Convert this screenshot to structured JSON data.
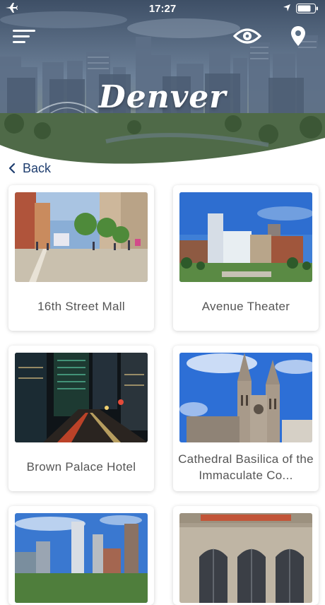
{
  "status_bar": {
    "time": "17:27",
    "airplane_icon": "airplane-icon",
    "location_icon": "location-arrow-icon",
    "battery_icon": "battery-icon"
  },
  "header": {
    "city_title": "Denver",
    "menu_icon": "hamburger-menu-icon",
    "view_icon": "eye-icon",
    "map_icon": "map-pin-icon"
  },
  "navigation": {
    "back_label": "Back"
  },
  "places": [
    {
      "name": "16th Street Mall",
      "image": "street-mall-photo"
    },
    {
      "name": "Avenue Theater",
      "image": "city-skyline-photo"
    },
    {
      "name": "Brown Palace Hotel",
      "image": "night-street-photo"
    },
    {
      "name": "Cathedral Basilica of the Immaculate Co...",
      "image": "cathedral-photo"
    },
    {
      "name": "",
      "image": "downtown-skyline-photo"
    },
    {
      "name": "",
      "image": "union-station-photo"
    }
  ],
  "colors": {
    "header_sky": "#5a6f86",
    "back_text": "#1f3e6f",
    "card_label": "#555555",
    "background": "#ffffff"
  }
}
